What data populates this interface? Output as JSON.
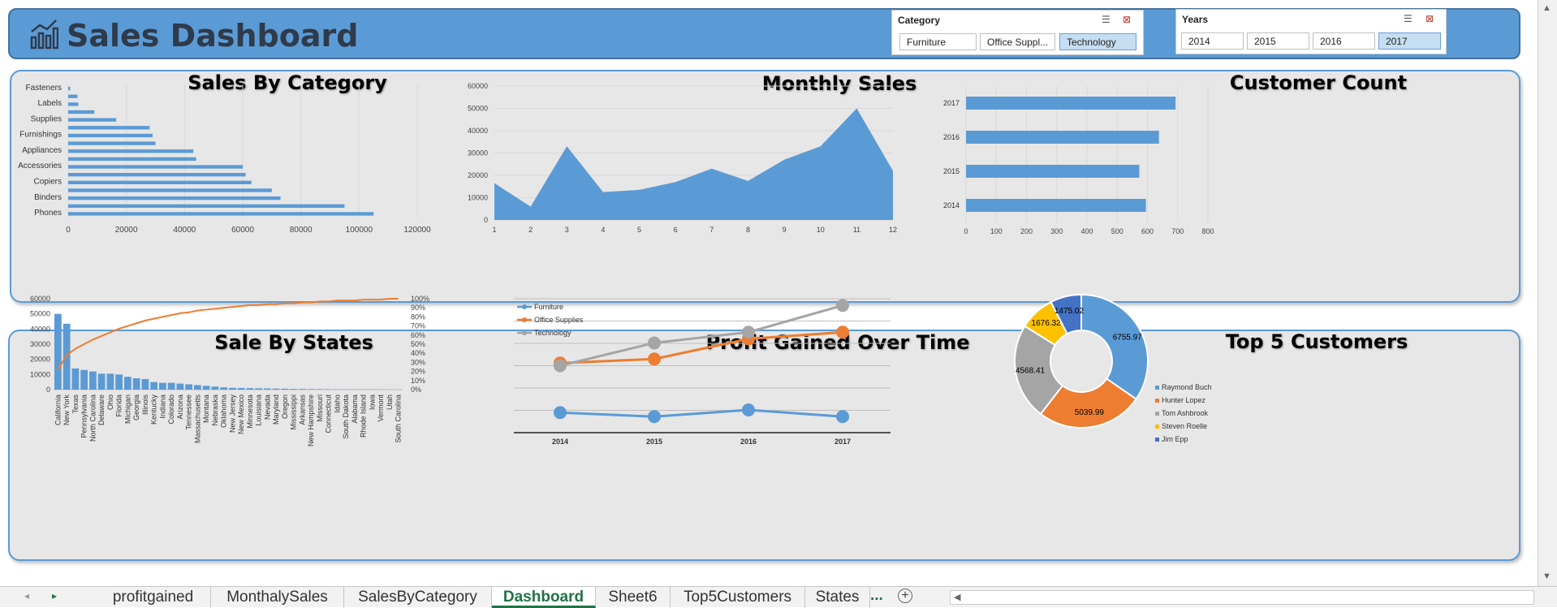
{
  "header": {
    "title": "Sales Dashboard",
    "icon": "bar-chart-icon"
  },
  "slicers": {
    "category": {
      "title": "Category",
      "items": [
        "Furniture",
        "Office Suppl...",
        "Technology"
      ],
      "selected": "Technology"
    },
    "years": {
      "title": "Years",
      "items": [
        "2014",
        "2015",
        "2016",
        "2017"
      ],
      "selected": "2017"
    }
  },
  "colors": {
    "blue": "#5b9bd5",
    "orange": "#ed7d31",
    "gray": "#a5a5a5",
    "yellow": "#ffc000",
    "darkblue": "#4472c4"
  },
  "chart_data": [
    {
      "type": "bar",
      "title": "Sales By Category",
      "orientation": "horizontal",
      "categories": [
        "Phones",
        "",
        "Binders",
        "",
        "Copiers",
        "",
        "Accessories",
        "",
        "Appliances",
        "",
        "Furnishings",
        "",
        "Supplies",
        "",
        "Labels",
        "",
        "Fasteners"
      ],
      "values": [
        105000,
        95000,
        73000,
        70000,
        63000,
        61000,
        60000,
        44000,
        43000,
        30000,
        29000,
        28000,
        16500,
        9000,
        3500,
        3200,
        700
      ],
      "xticks": [
        "0",
        "20000",
        "40000",
        "60000",
        "80000",
        "100000",
        "120000"
      ],
      "xlim": [
        0,
        120000
      ]
    },
    {
      "type": "area",
      "title": "Monthly Sales",
      "x": [
        "1",
        "2",
        "3",
        "4",
        "5",
        "6",
        "7",
        "8",
        "9",
        "10",
        "11",
        "12"
      ],
      "values": [
        16500,
        6000,
        33000,
        12500,
        13500,
        17000,
        23000,
        17500,
        27000,
        33000,
        50000,
        22000
      ],
      "yticks": [
        "0",
        "10000",
        "20000",
        "30000",
        "40000",
        "50000",
        "60000"
      ],
      "ylim": [
        0,
        60000
      ]
    },
    {
      "type": "bar",
      "title": "Customer Count",
      "orientation": "horizontal",
      "categories": [
        "2014",
        "2015",
        "2016",
        "2017"
      ],
      "values": [
        595,
        573,
        638,
        693
      ],
      "xticks": [
        "0",
        "100",
        "200",
        "300",
        "400",
        "500",
        "600",
        "700",
        "800"
      ],
      "xlim": [
        0,
        800
      ]
    },
    {
      "type": "bar",
      "title": "Sale By States",
      "pareto": true,
      "categories": [
        "California",
        "New York",
        "Texas",
        "Pennsylvania",
        "North Carolina",
        "Delaware",
        "Ohio",
        "Florida",
        "Michigan",
        "Georgia",
        "Illinois",
        "Kentucky",
        "Indiana",
        "Colorado",
        "Arizona",
        "Tennessee",
        "Massachusetts",
        "Montana",
        "Nebraska",
        "Oklahoma",
        "New Jersey",
        "New Mexico",
        "Minnesota",
        "Louisiana",
        "Nevada",
        "Maryland",
        "Oregon",
        "Mississippi",
        "Arkansas",
        "New Hampshire",
        "Missouri",
        "Connecticut",
        "Idaho",
        "South Dakota",
        "Alabama",
        "Rhode Island",
        "Iowa",
        "Vermont",
        "Utah",
        "South Carolina"
      ],
      "values": [
        50000,
        43500,
        14000,
        13000,
        12000,
        10500,
        10500,
        10000,
        8500,
        7500,
        7000,
        5000,
        4500,
        4500,
        4000,
        3500,
        3000,
        2500,
        2000,
        1500,
        1200,
        1100,
        1000,
        900,
        800,
        700,
        600,
        500,
        450,
        400,
        350,
        300,
        250,
        200,
        180,
        160,
        140,
        120,
        100,
        80
      ],
      "cumulative_pct": [
        22,
        38,
        45,
        50,
        55,
        59,
        63,
        67,
        70,
        73,
        76,
        78,
        80,
        82,
        84,
        85,
        87,
        88,
        89,
        90,
        91,
        92,
        93,
        93,
        94,
        94,
        95,
        95,
        96,
        96,
        97,
        97,
        98,
        98,
        98,
        99,
        99,
        99,
        100,
        100
      ],
      "yticks": [
        "0",
        "10000",
        "20000",
        "30000",
        "40000",
        "50000",
        "60000"
      ],
      "ylim": [
        0,
        60000
      ],
      "y2ticks": [
        "0%",
        "10%",
        "20%",
        "30%",
        "40%",
        "50%",
        "60%",
        "70%",
        "80%",
        "90%",
        "100%"
      ]
    },
    {
      "type": "line",
      "title": "Profit Gained Over Time",
      "x": [
        "2014",
        "2015",
        "2016",
        "2017"
      ],
      "series": [
        {
          "name": "Furniture",
          "values": [
            -5,
            -8,
            -3,
            -8
          ]
        },
        {
          "name": "Office Supplies",
          "values": [
            32,
            35,
            50,
            55
          ]
        },
        {
          "name": "Technology",
          "values": [
            30,
            47,
            55,
            75
          ]
        }
      ],
      "legend": "top-left",
      "ylim": [
        -20,
        80
      ]
    },
    {
      "type": "pie",
      "title": "Top 5 Customers",
      "donut": true,
      "labels": [
        "Raymond Buch",
        "Hunter Lopez",
        "Tom Ashbrook",
        "Steven Roelle",
        "Jim Epp"
      ],
      "values": [
        6755.97,
        5039.99,
        4568.41,
        1676.32,
        1475.02
      ],
      "value_labels": [
        "6755.97",
        "5039.99",
        "4568.41",
        "1676.32",
        "1475.02"
      ],
      "legend": "right"
    }
  ],
  "tabs": [
    "profitgained",
    "MonthalySales",
    "SalesByCategory",
    "Dashboard",
    "Sheet6",
    "Top5Customers",
    "States"
  ],
  "active_tab": "Dashboard",
  "tab_more": "...",
  "tab_add": "+"
}
